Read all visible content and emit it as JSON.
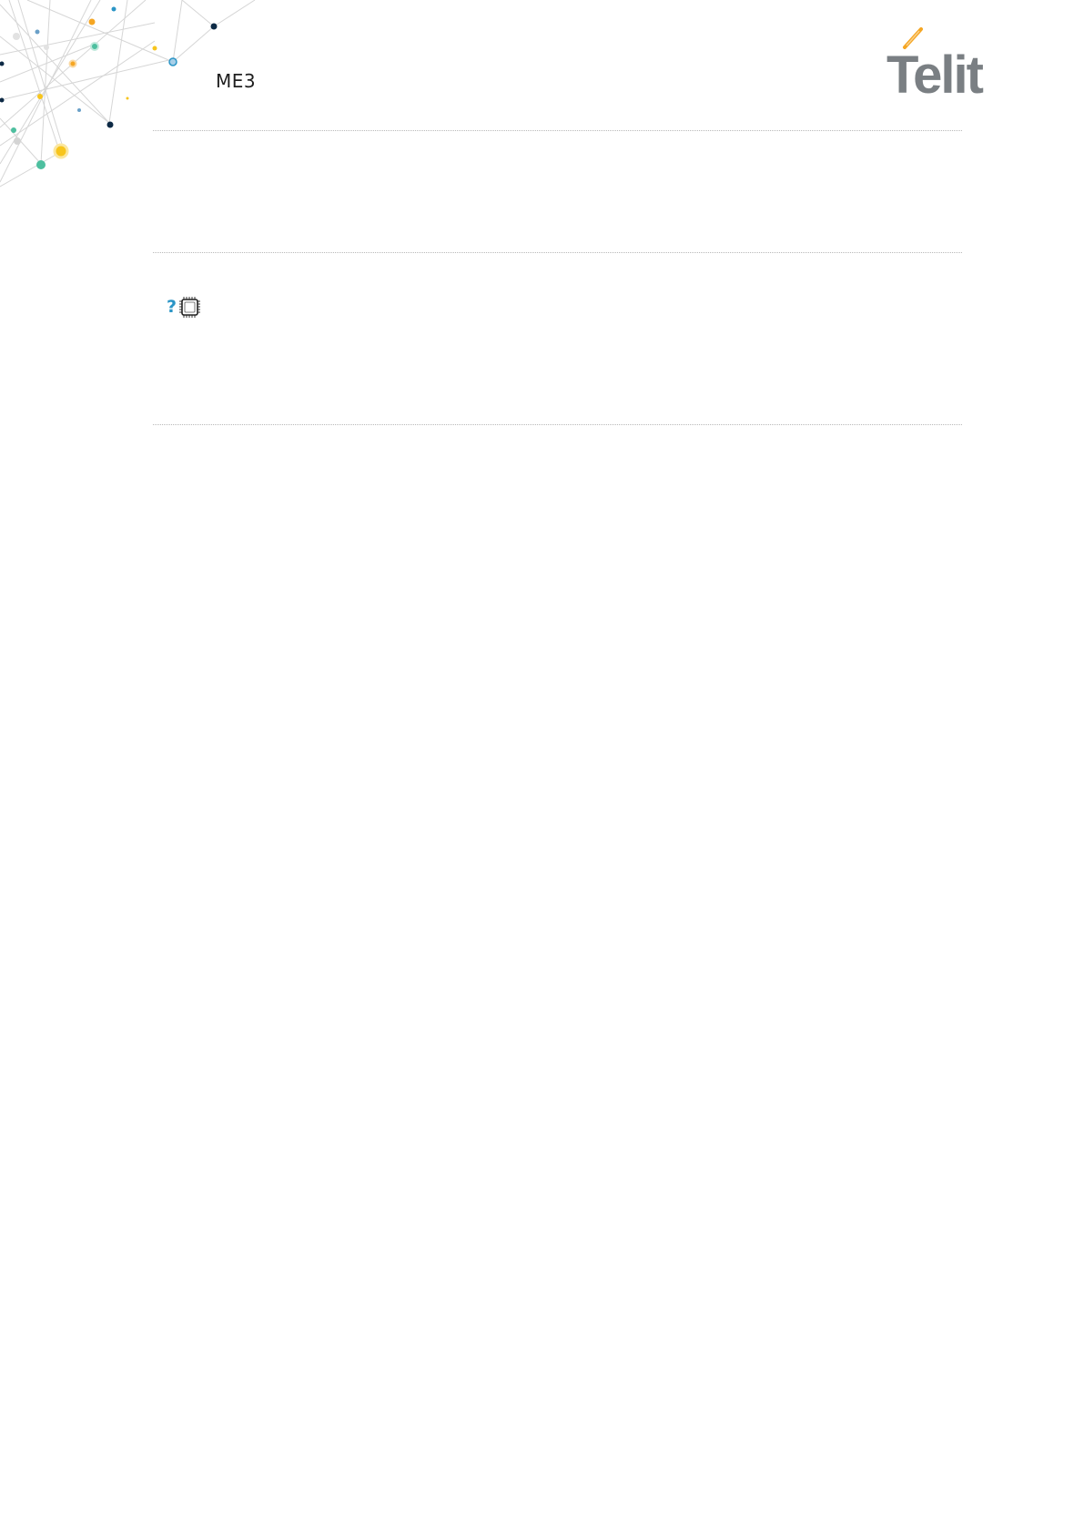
{
  "header": {
    "title": "ME3",
    "logo_text": "Telit"
  },
  "icons": {
    "header_art": "network-constellation-icon",
    "help": "question-mark-icon",
    "chip": "microchip-icon"
  },
  "colors": {
    "accent_blue": "#2b95c6",
    "logo_gray": "#7a7f83",
    "logo_orange": "#f5a623",
    "dot_navy": "#0d2a45",
    "dot_green": "#4dbf9f",
    "dot_yellow": "#f7c51d",
    "rule": "#b8b8b8"
  }
}
